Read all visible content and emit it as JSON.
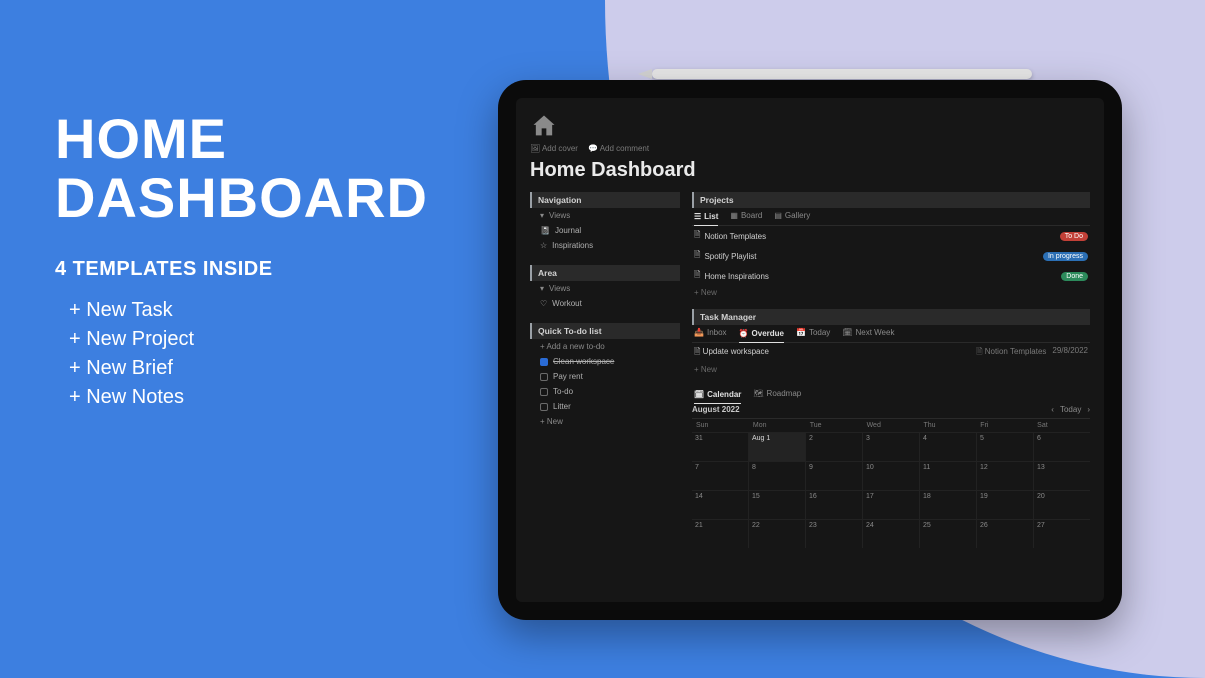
{
  "promo": {
    "title_line1": "HOME",
    "title_line2": "DASHBOARD",
    "subtitle": "4 TEMPLATES INSIDE",
    "templates": [
      "+ New Task",
      "+ New Project",
      "+ New Brief",
      "+ New Notes"
    ]
  },
  "header": {
    "add_cover": "Add cover",
    "add_comment": "Add comment",
    "page_title": "Home Dashboard"
  },
  "sidebar": {
    "navigation": {
      "label": "Navigation",
      "views_label": "Views",
      "items": [
        {
          "icon": "journal-icon",
          "label": "Journal"
        },
        {
          "icon": "star-icon",
          "label": "Inspirations"
        }
      ]
    },
    "area": {
      "label": "Area",
      "views_label": "Views",
      "items": [
        {
          "icon": "heart-icon",
          "label": "Workout"
        }
      ]
    },
    "todo": {
      "label": "Quick To-do list",
      "add_new": "+ Add a new to-do",
      "items": [
        {
          "checked": true,
          "label": "Clean workspace"
        },
        {
          "checked": false,
          "label": "Pay rent"
        },
        {
          "checked": false,
          "label": "To-do"
        },
        {
          "checked": false,
          "label": "Litter"
        }
      ],
      "new_label": "+ New"
    }
  },
  "projects": {
    "label": "Projects",
    "tabs": [
      {
        "icon": "list-icon",
        "label": "List"
      },
      {
        "icon": "board-icon",
        "label": "Board"
      },
      {
        "icon": "gallery-icon",
        "label": "Gallery"
      }
    ],
    "rows": [
      {
        "icon": "page-icon",
        "label": "Notion Templates",
        "badge": "To Do",
        "badge_color": "b-red"
      },
      {
        "icon": "page-icon",
        "label": "Spotify Playlist",
        "badge": "In progress",
        "badge_color": "b-blue"
      },
      {
        "icon": "page-icon",
        "label": "Home Inspirations",
        "badge": "Done",
        "badge_color": "b-green"
      }
    ],
    "new_label": "+ New"
  },
  "tasks": {
    "label": "Task Manager",
    "tabs": [
      {
        "label": "Inbox"
      },
      {
        "label": "Overdue"
      },
      {
        "label": "Today"
      },
      {
        "label": "Next Week"
      }
    ],
    "rows": [
      {
        "label": "Update workspace",
        "project": "Notion Templates",
        "date": "29/8/2022"
      }
    ],
    "new_label": "+ New"
  },
  "calendar": {
    "tabs": [
      {
        "icon": "calendar-icon",
        "label": "Calendar"
      },
      {
        "icon": "roadmap-icon",
        "label": "Roadmap"
      }
    ],
    "month": "August 2022",
    "today_label": "Today",
    "days": [
      "Sun",
      "Mon",
      "Tue",
      "Wed",
      "Thu",
      "Fri",
      "Sat"
    ],
    "weeks": [
      [
        "31",
        "Aug 1",
        "2",
        "3",
        "4",
        "5",
        "6"
      ],
      [
        "7",
        "8",
        "9",
        "10",
        "11",
        "12",
        "13"
      ],
      [
        "14",
        "15",
        "16",
        "17",
        "18",
        "19",
        "20"
      ],
      [
        "21",
        "22",
        "23",
        "24",
        "25",
        "26",
        "27"
      ]
    ]
  }
}
